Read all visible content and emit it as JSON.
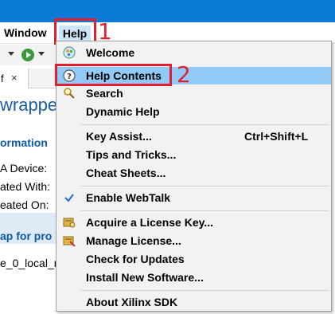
{
  "menubar": {
    "window_label": "Window",
    "help_label": "Help"
  },
  "callouts": {
    "one": "1",
    "two": "2"
  },
  "editor": {
    "tab_label": "f",
    "tab_close": "×",
    "title": "wrapper",
    "section_info": "ormation",
    "field_device": "A Device:",
    "field_created_with": "ated With:",
    "field_created_on": "eated On:",
    "section_map": "ap for pro",
    "field_value": "e_0_local_m"
  },
  "help_menu": {
    "items": [
      {
        "label": "Welcome",
        "icon": "welcome-icon"
      },
      {
        "label": "Help Contents",
        "icon": "help-icon"
      },
      {
        "label": "Search",
        "icon": "search-icon"
      },
      {
        "label": "Dynamic Help"
      },
      {
        "label": "Key Assist...",
        "accel": "Ctrl+Shift+L"
      },
      {
        "label": "Tips and Tricks..."
      },
      {
        "label": "Cheat Sheets..."
      },
      {
        "label": "Enable WebTalk",
        "icon": "checkmark-icon"
      },
      {
        "label": "Acquire a License Key...",
        "icon": "license-key-icon"
      },
      {
        "label": "Manage License...",
        "icon": "manage-license-icon"
      },
      {
        "label": "Check for Updates"
      },
      {
        "label": "Install New Software..."
      },
      {
        "label": "About Xilinx SDK"
      }
    ]
  },
  "colors": {
    "titlebar": "#0b79d6",
    "highlight": "#91c9f7",
    "callout": "#e0202e",
    "heading": "#0b5ba6"
  }
}
